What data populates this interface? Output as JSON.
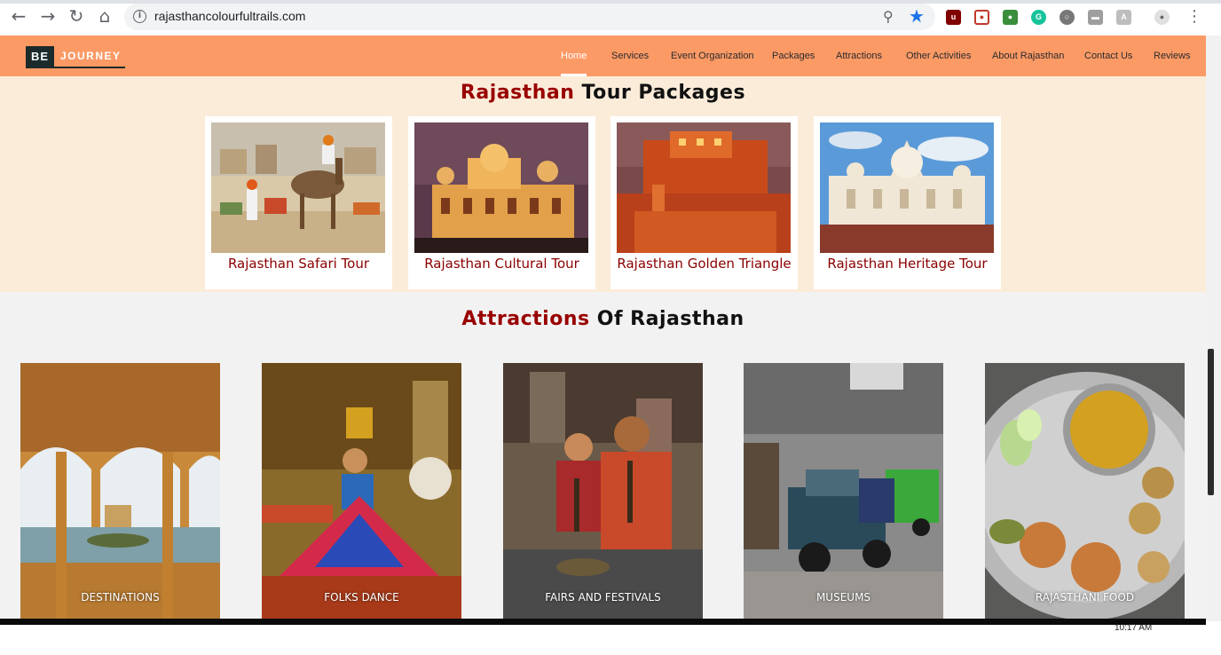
{
  "browser": {
    "url": "rajasthancolourfultrails.com"
  },
  "site": {
    "logo_be": "BE",
    "logo_journey": "JOURNEY",
    "menu": [
      {
        "label": "Home",
        "active": true
      },
      {
        "label": "Services"
      },
      {
        "label": "Event Organization"
      },
      {
        "label": "Packages"
      },
      {
        "label": "Attractions"
      },
      {
        "label": "Other Activities"
      },
      {
        "label": "About Rajasthan"
      },
      {
        "label": "Contact Us"
      },
      {
        "label": "Reviews"
      }
    ]
  },
  "packages": {
    "title_accent": "Rajasthan",
    "title_rest": " Tour Packages",
    "items": [
      {
        "label": "Rajasthan Safari Tour"
      },
      {
        "label": "Rajasthan Cultural Tour"
      },
      {
        "label": "Rajasthan Golden Triangle"
      },
      {
        "label": "Rajasthan Heritage Tour"
      }
    ]
  },
  "attractions": {
    "title_accent": "Attractions",
    "title_rest": " Of Rajasthan",
    "items": [
      {
        "label": "DESTINATIONS"
      },
      {
        "label": "FOLKS DANCE"
      },
      {
        "label": "FAIRS AND FESTIVALS"
      },
      {
        "label": "MUSEUMS"
      },
      {
        "label": "RAJASTHANI FOOD"
      }
    ]
  },
  "colors": {
    "nav_bg": "#fc9a66",
    "accent_red": "#990000",
    "packages_bg": "#fbecd9",
    "attractions_bg": "#f2f2f2"
  },
  "taskbar": {
    "clock": "10:17 AM"
  }
}
